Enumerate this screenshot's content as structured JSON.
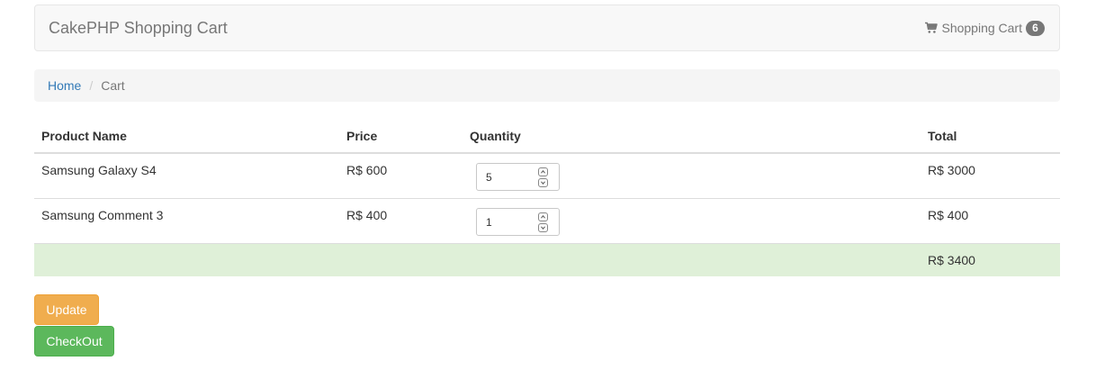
{
  "navbar": {
    "brand": "CakePHP Shopping Cart",
    "cart_label": "Shopping Cart",
    "cart_count": "6",
    "cart_icon": "shopping-cart-icon"
  },
  "breadcrumb": {
    "items": [
      {
        "label": "Home"
      },
      {
        "label": "Cart"
      }
    ],
    "separator": "/"
  },
  "table": {
    "headers": [
      "Product Name",
      "Price",
      "Quantity",
      "",
      "Total"
    ],
    "rows": [
      {
        "name": "Samsung Galaxy S4",
        "price": "R$ 600",
        "quantity": "5",
        "total": "R$ 3000"
      },
      {
        "name": "Samsung Comment 3",
        "price": "R$ 400",
        "quantity": "1",
        "total": "R$ 400"
      }
    ],
    "grand_total": "R$ 3400"
  },
  "buttons": {
    "update": "Update",
    "checkout": "CheckOut"
  },
  "colors": {
    "update": "#f0ad4e",
    "checkout": "#5cb85c",
    "total_row": "#dff0d8",
    "link": "#337ab7"
  }
}
